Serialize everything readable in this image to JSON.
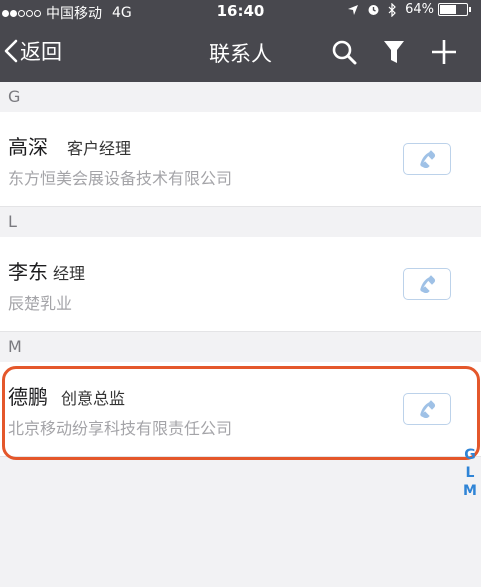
{
  "status_bar": {
    "carrier": "中国移动",
    "network": "4G",
    "time": "16:40",
    "battery": "64%",
    "battery_level": 0.64
  },
  "nav": {
    "back_label": "返回",
    "title": "联系人"
  },
  "sections": [
    {
      "letter": "G",
      "contacts": [
        {
          "name": "高深",
          "title": "客户经理",
          "company": "东方恒美会展设备技术有限公司"
        }
      ]
    },
    {
      "letter": "L",
      "contacts": [
        {
          "name": "李东",
          "title": "经理",
          "company": "辰楚乳业"
        }
      ]
    },
    {
      "letter": "M",
      "contacts": [
        {
          "name": "德鹏",
          "title": "创意总监",
          "company": "北京移动纷享科技有限责任公司"
        }
      ]
    }
  ],
  "index_letters": [
    "G",
    "L",
    "M"
  ],
  "colors": {
    "nav_bg": "#48484e",
    "accent": "#2f84d6",
    "highlight": "#e4572b",
    "call_icon": "#9fc1e6"
  }
}
